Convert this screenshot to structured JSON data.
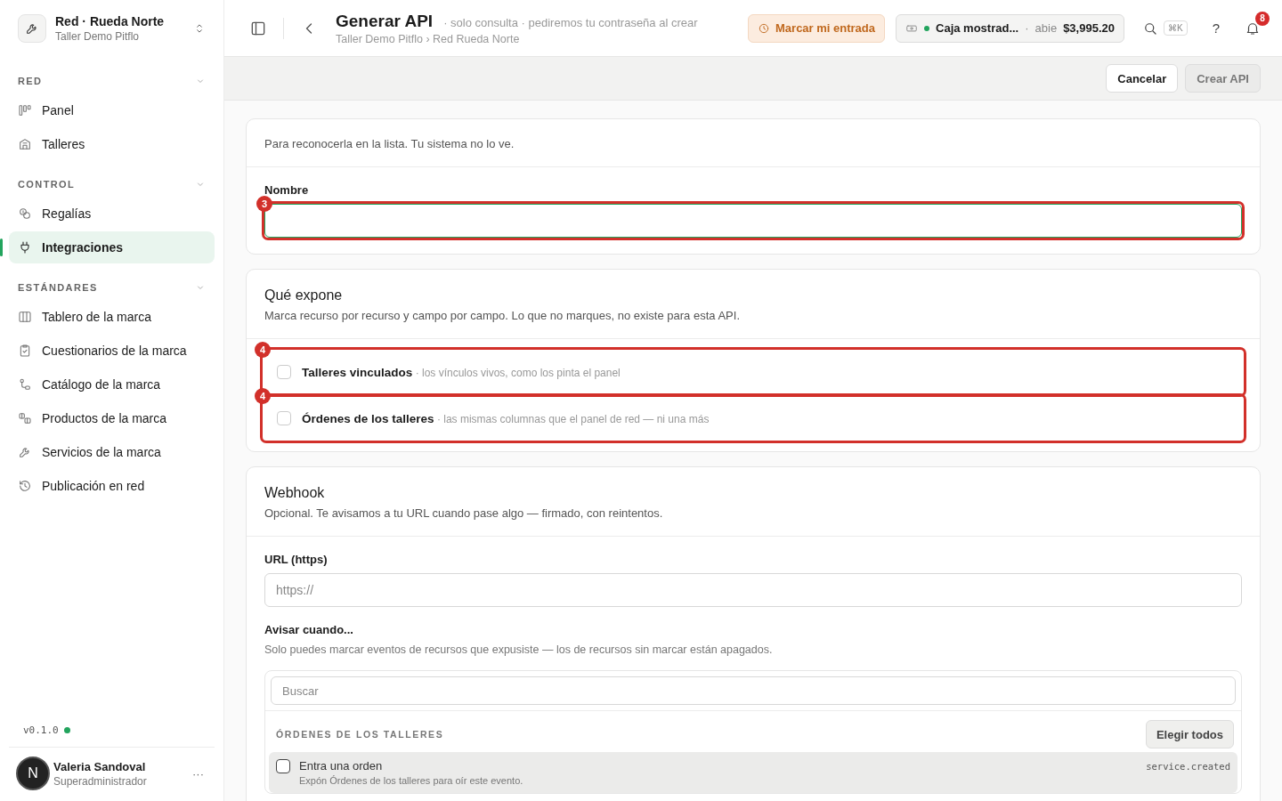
{
  "sidebar": {
    "brand": {
      "title": "Red · Rueda Norte",
      "subtitle": "Taller Demo Pitflo"
    },
    "sections": [
      {
        "label": "RED",
        "expanded": true,
        "items": [
          {
            "label": "Panel",
            "selected": false
          },
          {
            "label": "Talleres",
            "selected": false
          }
        ]
      },
      {
        "label": "CONTROL",
        "expanded": true,
        "items": [
          {
            "label": "Regalías",
            "selected": false
          },
          {
            "label": "Integraciones",
            "selected": true
          }
        ]
      },
      {
        "label": "ESTÁNDARES",
        "expanded": true,
        "items": [
          {
            "label": "Tablero de la marca",
            "selected": false
          },
          {
            "label": "Cuestionarios de la marca",
            "selected": false
          },
          {
            "label": "Catálogo de la marca",
            "selected": false
          },
          {
            "label": "Productos de la marca",
            "selected": false
          },
          {
            "label": "Servicios de la marca",
            "selected": false
          },
          {
            "label": "Publicación en red",
            "selected": false
          }
        ]
      }
    ],
    "version": "v0.1.0",
    "online": true,
    "user": {
      "initial": "N",
      "name": "Valeria Sandoval",
      "role": "Superadministrador",
      "menu": "···"
    }
  },
  "header": {
    "title": "Generar API",
    "subtitle": "· solo consulta · pediremos tu contraseña al crear",
    "breadcrumb": "Taller Demo Pitflo › Red Rueda Norte",
    "clock_in": "Marcar mi entrada",
    "register": {
      "name": "Caja mostrad...",
      "separator": "·",
      "status": "abie",
      "amount": "$3,995.20",
      "open": true
    },
    "shortcut": "⌘K",
    "help": "?",
    "notifications": "8"
  },
  "toolbar": {
    "buttons": [
      {
        "label": "Cancelar",
        "disabled": false
      },
      {
        "label": "Crear API",
        "disabled": true
      }
    ]
  },
  "name_card": {
    "description": "Para reconocerla en la lista. Tu sistema no lo ve.",
    "label": "Nombre",
    "focused": true,
    "annotation": "3"
  },
  "expose_card": {
    "title": "Qué expone",
    "description": "Marca recurso por recurso y campo por campo. Lo que no marques, no existe para esta API.",
    "items": [
      {
        "label": "Talleres vinculados",
        "hint": "· los vínculos vivos, como los pinta el panel",
        "checked": false,
        "annotation": "4"
      },
      {
        "label": "Órdenes de los talleres",
        "hint": "· las mismas columnas que el panel de red — ni una más",
        "checked": false,
        "annotation": "4"
      }
    ]
  },
  "webhook_card": {
    "title": "Webhook",
    "description": "Opcional. Te avisamos a tu URL cuando pase algo — firmado, con reintentos.",
    "url_label": "URL (https)",
    "url_placeholder": "https://",
    "events_label": "Avisar cuando...",
    "events_hint": "Solo puedes marcar eventos de recursos que expusiste — los de recursos sin marcar están apagados.",
    "search_placeholder": "Buscar",
    "groups": [
      {
        "label": "ÓRDENES DE LOS TALLERES",
        "action": "Elegir todos",
        "events": [
          {
            "label": "Entra una orden",
            "code": "service.created",
            "description": "Expón Órdenes de los talleres para oír este evento.",
            "checked": false,
            "disabled": true
          }
        ]
      }
    ]
  }
}
